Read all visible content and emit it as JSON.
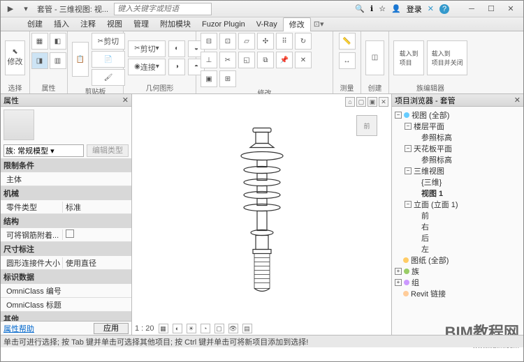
{
  "titlebar": {
    "title": "套管 - 三维视图: 视...",
    "search_placeholder": "键入关键字或短语",
    "login": "登录"
  },
  "menus": {
    "m0": "创建",
    "m1": "插入",
    "m2": "注释",
    "m3": "视图",
    "m4": "管理",
    "m5": "附加模块",
    "m6": "Fuzor Plugin",
    "m7": "V-Ray",
    "m8": "修改"
  },
  "ribbon": {
    "g0": "选择",
    "g1": "属性",
    "g2": "剪贴板",
    "g3": "几何图形",
    "g4": "修改",
    "g5": "测量",
    "g6": "创建",
    "g7": "族编辑器",
    "modify": "修改",
    "cut": "剪切",
    "join": "连接",
    "load_proj": "载入到\n项目",
    "load_close": "载入到\n项目并关闭"
  },
  "prop": {
    "title": "属性",
    "family": "族: 常规模型",
    "edit_type": "编辑类型",
    "grp_constraint": "限制条件",
    "host": "主体",
    "grp_mech": "机械",
    "part_type": "零件类型",
    "part_val": "标准",
    "grp_struct": "结构",
    "rebar": "可将钢筋附着...",
    "grp_dim": "尺寸标注",
    "round_conn": "圆形连接件大小",
    "round_val": "使用直径",
    "grp_id": "标识数据",
    "omni_num": "OmniClass 编号",
    "omni_title": "OmniClass 标题",
    "grp_other": "其他",
    "help": "属性帮助",
    "apply": "应用"
  },
  "viewport": {
    "scale": "1 : 20",
    "cube": "前"
  },
  "browser": {
    "title": "项目浏览器 - 套管",
    "views": "视图 (全部)",
    "floor": "楼层平面",
    "ref1": "参照标高",
    "ceil": "天花板平面",
    "ref2": "参照标高",
    "v3d": "三维视图",
    "v3d1": "{三维}",
    "v3d2": "视图 1",
    "elev": "立面 (立面 1)",
    "e1": "前",
    "e2": "右",
    "e3": "后",
    "e4": "左",
    "sheets": "图纸 (全部)",
    "fam": "族",
    "grp": "组",
    "revit": "Revit 链接"
  },
  "status": "单击可进行选择; 按 Tab 键并单击可选择其他项目; 按 Ctrl 键并单击可将新项目添加到选择!",
  "watermark": {
    "big": "BIM教程网",
    "url": "www.ifbim.com"
  }
}
